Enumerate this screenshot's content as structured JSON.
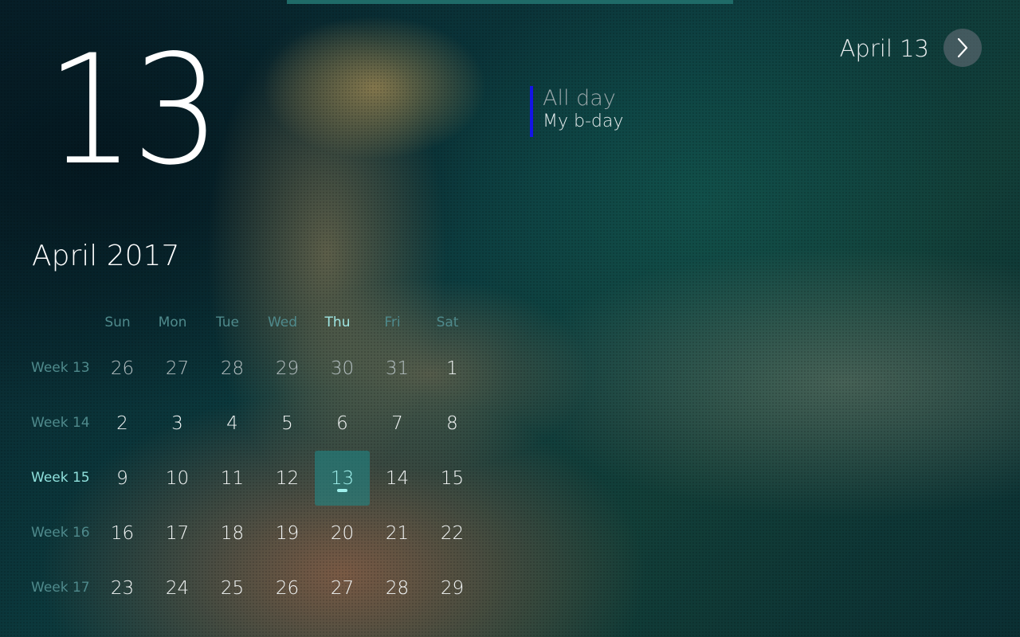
{
  "header": {
    "day_number": "13",
    "nav_date": "April 13",
    "next_icon": "chevron-right-icon"
  },
  "event": {
    "time": "All day",
    "title": "My b-day",
    "color": "#1414e6"
  },
  "calendar": {
    "month_title": "April 2017",
    "weekdays": [
      "Sun",
      "Mon",
      "Tue",
      "Wed",
      "Thu",
      "Fri",
      "Sat"
    ],
    "current_weekday_index": 4,
    "weeks": [
      {
        "label": "Week 13",
        "days": [
          "26",
          "27",
          "28",
          "29",
          "30",
          "31",
          "1"
        ],
        "other_month": [
          true,
          true,
          true,
          true,
          true,
          true,
          false
        ]
      },
      {
        "label": "Week 14",
        "days": [
          "2",
          "3",
          "4",
          "5",
          "6",
          "7",
          "8"
        ],
        "other_month": [
          false,
          false,
          false,
          false,
          false,
          false,
          false
        ]
      },
      {
        "label": "Week 15",
        "days": [
          "9",
          "10",
          "11",
          "12",
          "13",
          "14",
          "15"
        ],
        "other_month": [
          false,
          false,
          false,
          false,
          false,
          false,
          false
        ]
      },
      {
        "label": "Week 16",
        "days": [
          "16",
          "17",
          "18",
          "19",
          "20",
          "21",
          "22"
        ],
        "other_month": [
          false,
          false,
          false,
          false,
          false,
          false,
          false
        ]
      },
      {
        "label": "Week 17",
        "days": [
          "23",
          "24",
          "25",
          "26",
          "27",
          "28",
          "29"
        ],
        "other_month": [
          false,
          false,
          false,
          false,
          false,
          false,
          false
        ]
      }
    ],
    "selected_week_index": 2,
    "selected_day_index": 4,
    "accent_color": "#1e8c8c"
  }
}
